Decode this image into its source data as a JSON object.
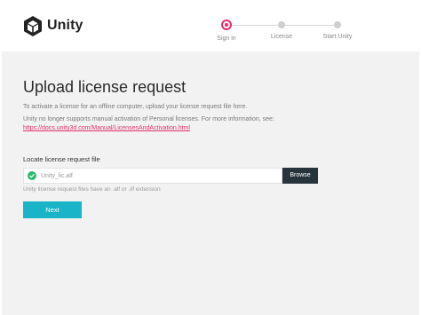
{
  "brand": {
    "name": "Unity",
    "icon": "unity-cube-logo"
  },
  "stepper": {
    "steps": [
      {
        "label": "Sign in",
        "active": true
      },
      {
        "label": "License",
        "active": false
      },
      {
        "label": "Start Unity",
        "active": false
      }
    ],
    "accent": "#e3306d"
  },
  "main": {
    "title": "Upload license request",
    "description": "To activate a license for an offline computer, upload your license request file here.",
    "notice": "Unity no longer supports manual activation of Personal licenses. For more information, see:",
    "doc_link": "https://docs.unity3d.com/Manual/LicensesAndActivation.html",
    "field_label": "Locate license request file",
    "file_value": "Unity_lic.alf",
    "file_status_icon": "check-circle-icon",
    "browse_label": "Browse",
    "hint": "Unity license request files have an .alf or .ilf extension",
    "next_label": "Next"
  },
  "colors": {
    "primary_button": "#19b4c8",
    "browse_button": "#27343c",
    "success": "#2db86b",
    "link": "#e3306d"
  }
}
